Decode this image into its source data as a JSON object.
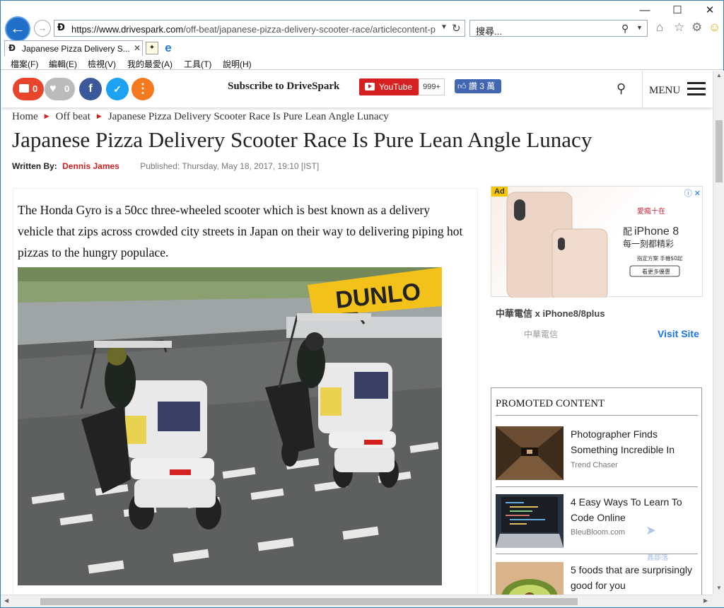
{
  "browser": {
    "url_host": "https://www.drivespark.com",
    "url_path": "/off-beat/japanese-pizza-delivery-scooter-race/articlecontent-p",
    "search_placeholder": "搜尋...",
    "tab_title": "Japanese Pizza Delivery S...",
    "menu": [
      "檔案(F)",
      "編輯(E)",
      "檢視(V)",
      "我的最愛(A)",
      "工具(T)",
      "說明(H)"
    ]
  },
  "site_header": {
    "comments_count": "0",
    "likes_count": "0",
    "subscribe_text": "Subscribe to DriveSpark",
    "youtube_label": "YouTube",
    "youtube_count": "999+",
    "fb_like_label": "讚 3 萬",
    "menu_label": "MENU"
  },
  "breadcrumb": [
    "Home",
    "Off beat",
    "Japanese Pizza Delivery Scooter Race Is Pure Lean Angle Lunacy"
  ],
  "article": {
    "title": "Japanese Pizza Delivery Scooter Race Is Pure Lean Angle Lunacy",
    "written_by_label": "Written By:",
    "author": "Dennis James",
    "published": "Published: Thursday, May 18, 2017, 19:10 [IST]",
    "intro": "The Honda Gyro is a 50cc three-wheeled scooter which is best known as a delivery vehicle that zips across crowded city streets in Japan on their way to delivering piping hot pizzas to the hungry populace.",
    "image_banner_text": "DUNLO"
  },
  "ad": {
    "tag": "Ad",
    "product": "iPhone 8",
    "tagline_prefix": "配",
    "tagline": "每一刻都精彩",
    "brand_text": "愛瘋十在",
    "fine_print": "指定方案  手機$0起",
    "cta": "看更多優惠",
    "title": "中華電信 x iPhone8/8plus",
    "source": "中華電信",
    "visit": "Visit Site"
  },
  "promoted": {
    "heading": "PROMOTED CONTENT",
    "items": [
      {
        "title": "Photographer Finds Something Incredible In",
        "source": "Trend Chaser"
      },
      {
        "title": "4 Easy Ways To Learn To Code Online",
        "source": "BleuBloom.com"
      },
      {
        "title": "5 foods that are surprisingly good for you",
        "source": ""
      }
    ]
  },
  "watermark": "鑫部落",
  "colors": {
    "accent_red": "#d42020",
    "facebook": "#3b5998",
    "twitter": "#1da1f2",
    "orange": "#f47a20",
    "link_blue": "#1a73e8",
    "ie_blue": "#1f6fc9"
  }
}
